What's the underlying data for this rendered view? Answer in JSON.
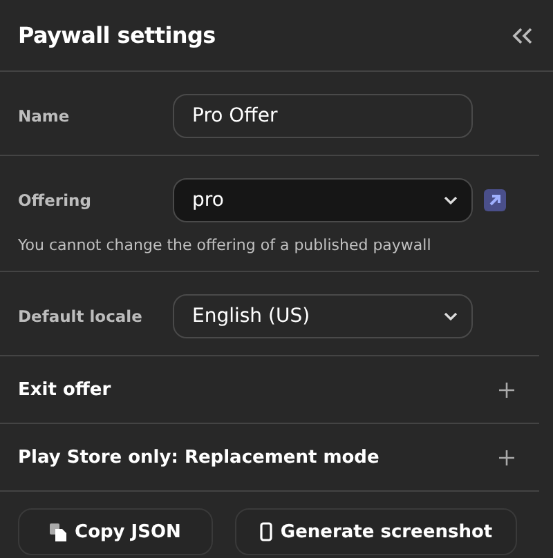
{
  "title": "Paywall settings",
  "fields": [
    {
      "kind": "text",
      "label": "Name",
      "value": "Pro Offer"
    },
    {
      "kind": "select",
      "label": "Offering",
      "value": "pro",
      "disabled": true,
      "note": "You cannot change the offering of a published paywall"
    },
    {
      "kind": "select",
      "label": "Default locale",
      "value": "English (US)",
      "disabled": false
    }
  ],
  "sections": [
    {
      "label": "Exit offer",
      "expanded": false
    },
    {
      "label": "Play Store only: Replacement mode",
      "expanded": false
    }
  ],
  "buttons": [
    {
      "kind": "copy",
      "label": "Copy JSON"
    },
    {
      "kind": "phone",
      "label": "Generate screenshot"
    }
  ]
}
